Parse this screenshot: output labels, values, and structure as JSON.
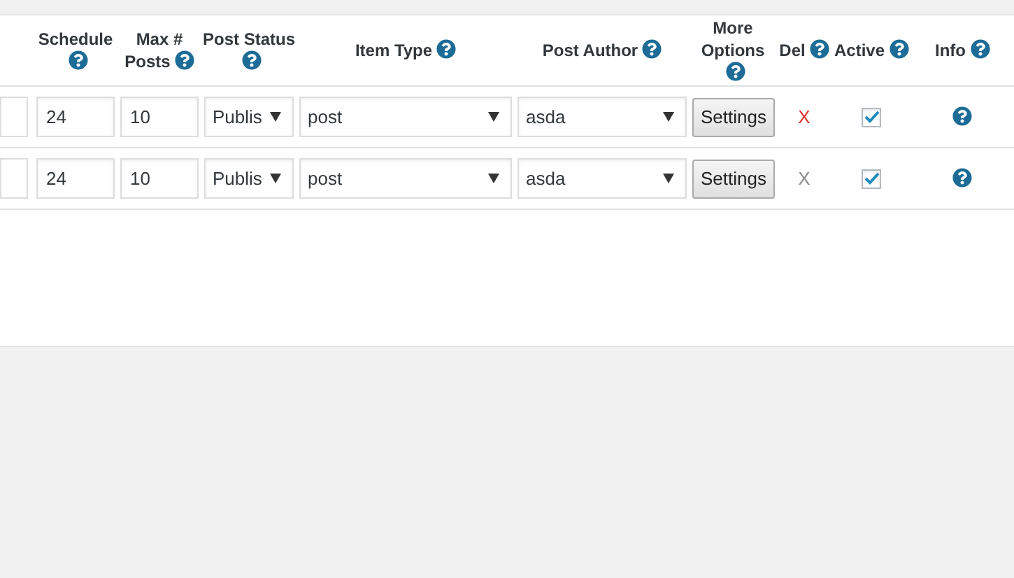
{
  "columns": [
    {
      "label": "Schedule"
    },
    {
      "label": "Max # Posts"
    },
    {
      "label": "Post Status"
    },
    {
      "label": "Item Type"
    },
    {
      "label": "Post Author"
    },
    {
      "label": "More Options"
    },
    {
      "label": "Del"
    },
    {
      "label": "Active"
    },
    {
      "label": "Info"
    }
  ],
  "rows": [
    {
      "schedule": "24",
      "max_posts": "10",
      "post_status": "Publis",
      "item_type": "post",
      "post_author": "asda",
      "settings": "Settings",
      "del": "X",
      "del_highlighted": true,
      "active": true
    },
    {
      "schedule": "24",
      "max_posts": "10",
      "post_status": "Publis",
      "item_type": "post",
      "post_author": "asda",
      "settings": "Settings",
      "del": "X",
      "del_highlighted": false,
      "active": true
    }
  ]
}
